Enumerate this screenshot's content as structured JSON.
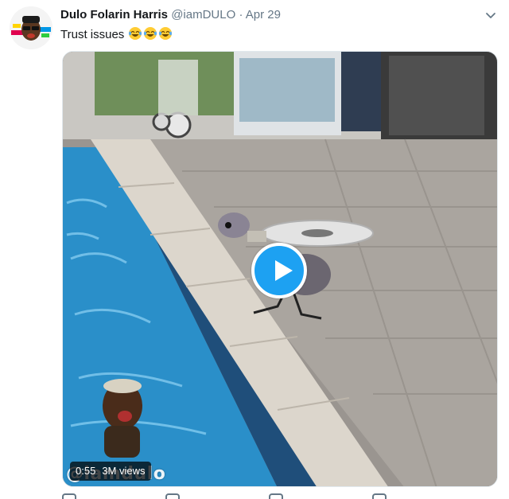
{
  "tweet": {
    "author_name": "Dulo Folarin Harris",
    "handle": "@iamDULO",
    "separator": "·",
    "date": "Apr 29",
    "text": "Trust issues",
    "emojis": [
      "face-with-tears-of-joy",
      "face-with-tears-of-joy",
      "face-with-tears-of-joy"
    ]
  },
  "video": {
    "duration": "0:55",
    "views": "3M views",
    "watermark": "@iamdulo"
  },
  "icons": {
    "menu": "chevron-down-icon",
    "play": "play-icon"
  },
  "colors": {
    "accent": "#1da1f2",
    "text": "#14171a",
    "muted": "#657786",
    "pool_water": "#2a8fc9"
  }
}
